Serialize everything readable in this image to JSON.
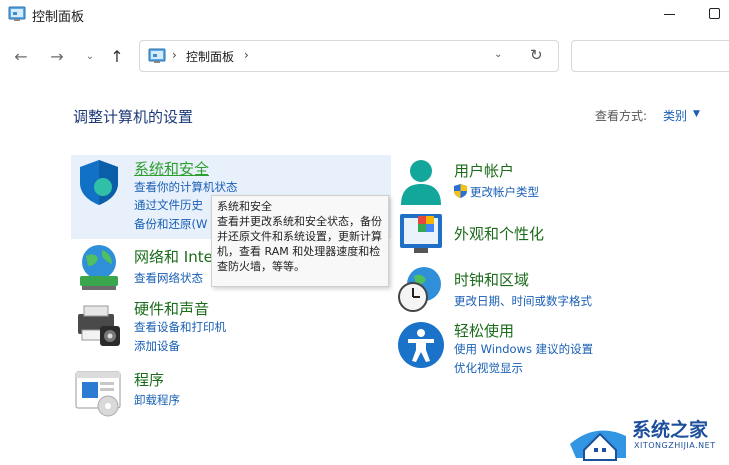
{
  "window": {
    "title": "控制面板",
    "icon": "control-panel-icon"
  },
  "nav": {
    "back_icon": "arrow-left-icon",
    "forward_icon": "arrow-right-icon",
    "recent_icon": "chevron-down-icon",
    "up_icon": "arrow-up-icon",
    "address_sep": "›",
    "address_path": "控制面板",
    "refresh_icon": "refresh-icon"
  },
  "header": {
    "title": "调整计算机的设置",
    "view_label": "查看方式:",
    "view_value": "类别",
    "view_caret": "▼"
  },
  "categories": [
    {
      "id": "security",
      "title": "系统和安全",
      "icon": "shield-icon",
      "links": [
        "查看你的计算机状态",
        "通过文件历史",
        "备份和还原(W"
      ]
    },
    {
      "id": "network",
      "title": "网络和 Inte",
      "icon": "network-globe-icon",
      "links": [
        "查看网络状态"
      ]
    },
    {
      "id": "hardware",
      "title": "硬件和声音",
      "icon": "printer-icon",
      "links": [
        "查看设备和打印机",
        "添加设备"
      ]
    },
    {
      "id": "programs",
      "title": "程序",
      "icon": "programs-icon",
      "links": [
        "卸载程序"
      ]
    },
    {
      "id": "accounts",
      "title": "用户帐户",
      "icon": "user-icon",
      "links": [
        "更改帐户类型"
      ]
    },
    {
      "id": "appearance",
      "title": "外观和个性化",
      "icon": "appearance-icon",
      "links": []
    },
    {
      "id": "clock",
      "title": "时钟和区域",
      "icon": "clock-globe-icon",
      "links": [
        "更改日期、时间或数字格式"
      ]
    },
    {
      "id": "ease",
      "title": "轻松使用",
      "icon": "accessibility-icon",
      "links": [
        "使用 Windows 建议的设置",
        "优化视觉显示"
      ]
    }
  ],
  "tooltip": {
    "title": "系统和安全",
    "body": "查看并更改系统和安全状态，备份并还原文件和系统设置，更新计算机，查看 RAM 和处理器速度和检查防火墙，等等。"
  },
  "watermark": {
    "text": "系统之家",
    "sub": "XITONGZHIJIA.NET"
  },
  "colors": {
    "category_title": "#1a6b1a",
    "link": "#1a5fb4",
    "heading": "#1e3a78",
    "highlight": "#e8f1fb"
  }
}
